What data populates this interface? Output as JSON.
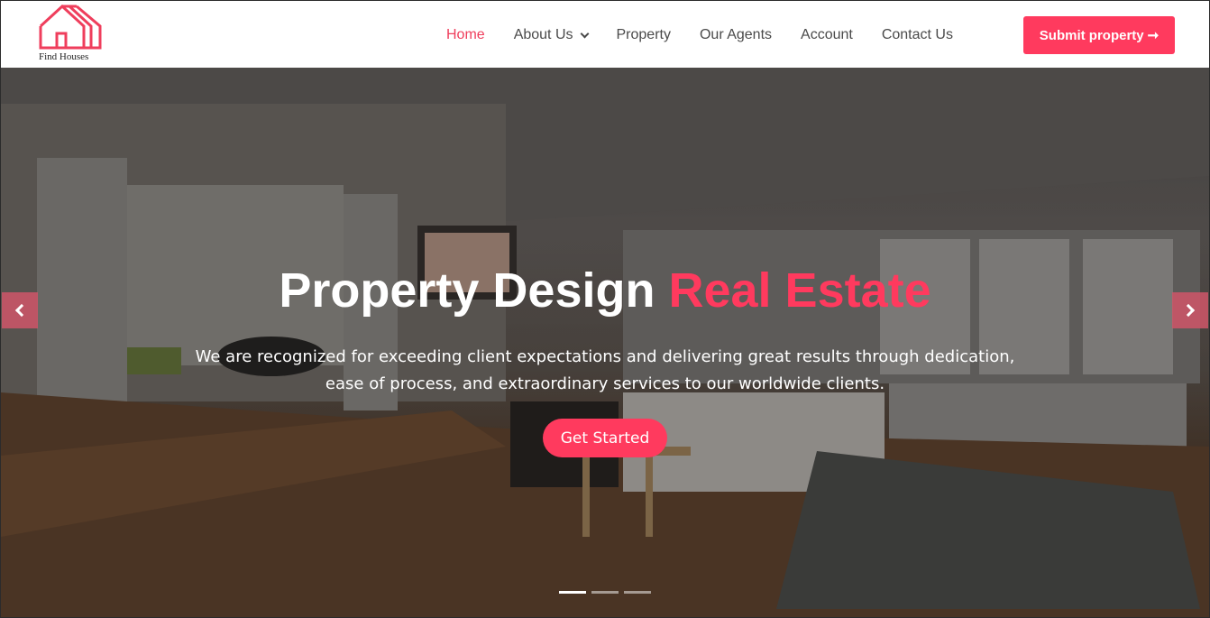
{
  "brand": {
    "name": "Find Houses",
    "accent": "#ff3a5e"
  },
  "nav": {
    "items": [
      {
        "label": "Home",
        "active": true
      },
      {
        "label": "About Us",
        "dropdown": true
      },
      {
        "label": "Property"
      },
      {
        "label": "Our Agents"
      },
      {
        "label": "Account"
      },
      {
        "label": "Contact Us"
      }
    ],
    "submit_label": "Submit property",
    "submit_icon": "arrow-right-icon"
  },
  "hero": {
    "title_main": "Property Design",
    "title_accent": "Real Estate",
    "subtitle": "We are recognized for exceeding client expectations and delivering great results through dedication, ease of process, and extraordinary services to our worldwide clients.",
    "cta_label": "Get Started",
    "slides": 3,
    "active_slide": 0
  }
}
